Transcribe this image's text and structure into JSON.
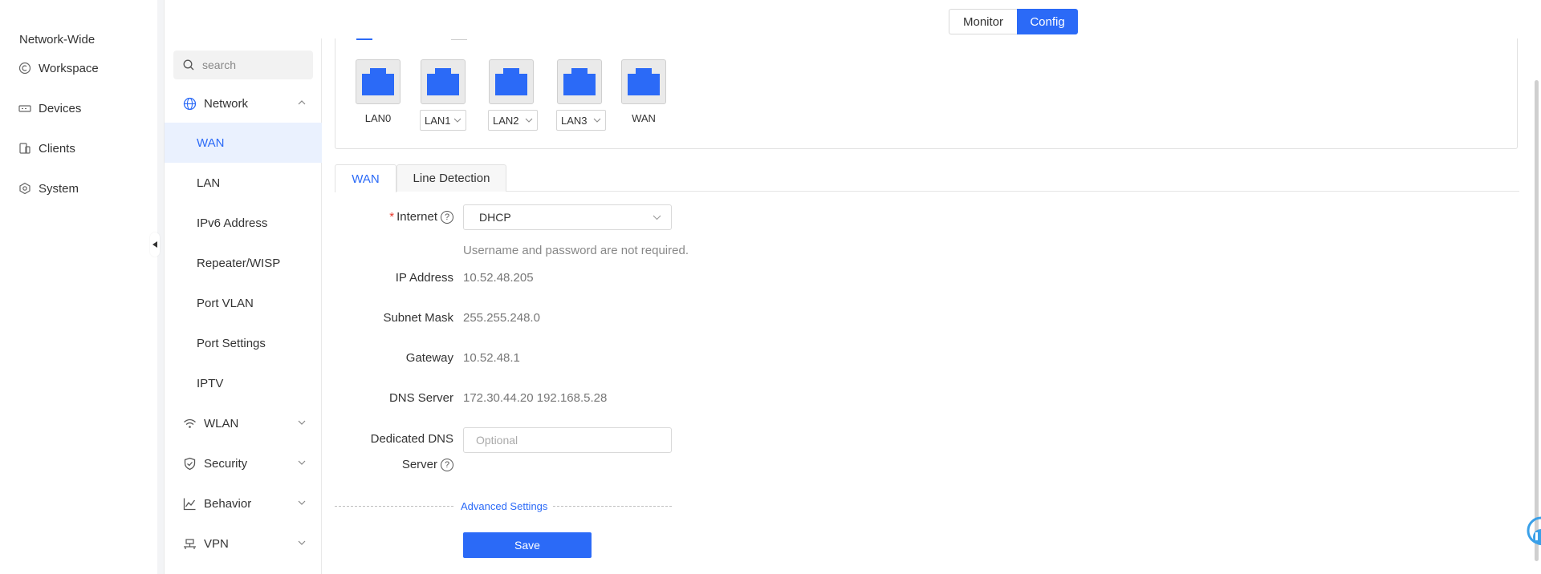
{
  "global_nav": {
    "title": "Network-Wide",
    "items": [
      {
        "label": "Workspace",
        "icon": "workspace-icon"
      },
      {
        "label": "Devices",
        "icon": "devices-icon"
      },
      {
        "label": "Clients",
        "icon": "clients-icon"
      },
      {
        "label": "System",
        "icon": "system-icon"
      }
    ]
  },
  "mode_switch": {
    "monitor": "Monitor",
    "config": "Config",
    "selected": "Config"
  },
  "subnav": {
    "search_placeholder": "search",
    "groups": [
      {
        "label": "Network",
        "expanded": true
      },
      {
        "label": "WLAN",
        "expanded": false
      },
      {
        "label": "Security",
        "expanded": false
      },
      {
        "label": "Behavior",
        "expanded": false
      },
      {
        "label": "VPN",
        "expanded": false
      }
    ],
    "network_items": [
      "WAN",
      "LAN",
      "IPv6 Address",
      "Repeater/WISP",
      "Port VLAN",
      "Port Settings",
      "IPTV"
    ],
    "active_item": "WAN"
  },
  "ports": [
    {
      "label": "LAN0",
      "dropdown": false
    },
    {
      "label": "LAN1",
      "dropdown": true
    },
    {
      "label": "LAN2",
      "dropdown": true
    },
    {
      "label": "LAN3",
      "dropdown": true
    },
    {
      "label": "WAN",
      "dropdown": false
    }
  ],
  "tabs": [
    "WAN",
    "Line Detection"
  ],
  "active_tab": "WAN",
  "form": {
    "internet_label": "Internet",
    "internet_value": "DHCP",
    "internet_hint": "Username and password are not required.",
    "ip_label": "IP Address",
    "ip_value": "10.52.48.205",
    "mask_label": "Subnet Mask",
    "mask_value": "255.255.248.0",
    "gateway_label": "Gateway",
    "gateway_value": "10.52.48.1",
    "dns_label": "DNS Server",
    "dns_value": "172.30.44.20 192.168.5.28",
    "dedicated_dns_label_1": "Dedicated DNS",
    "dedicated_dns_label_2": "Server",
    "dedicated_dns_placeholder": "Optional",
    "advanced_link": "Advanced Settings",
    "save_label": "Save"
  },
  "colors": {
    "accent": "#2b6af7",
    "required": "#e8372b",
    "port": "#2b6af7"
  }
}
